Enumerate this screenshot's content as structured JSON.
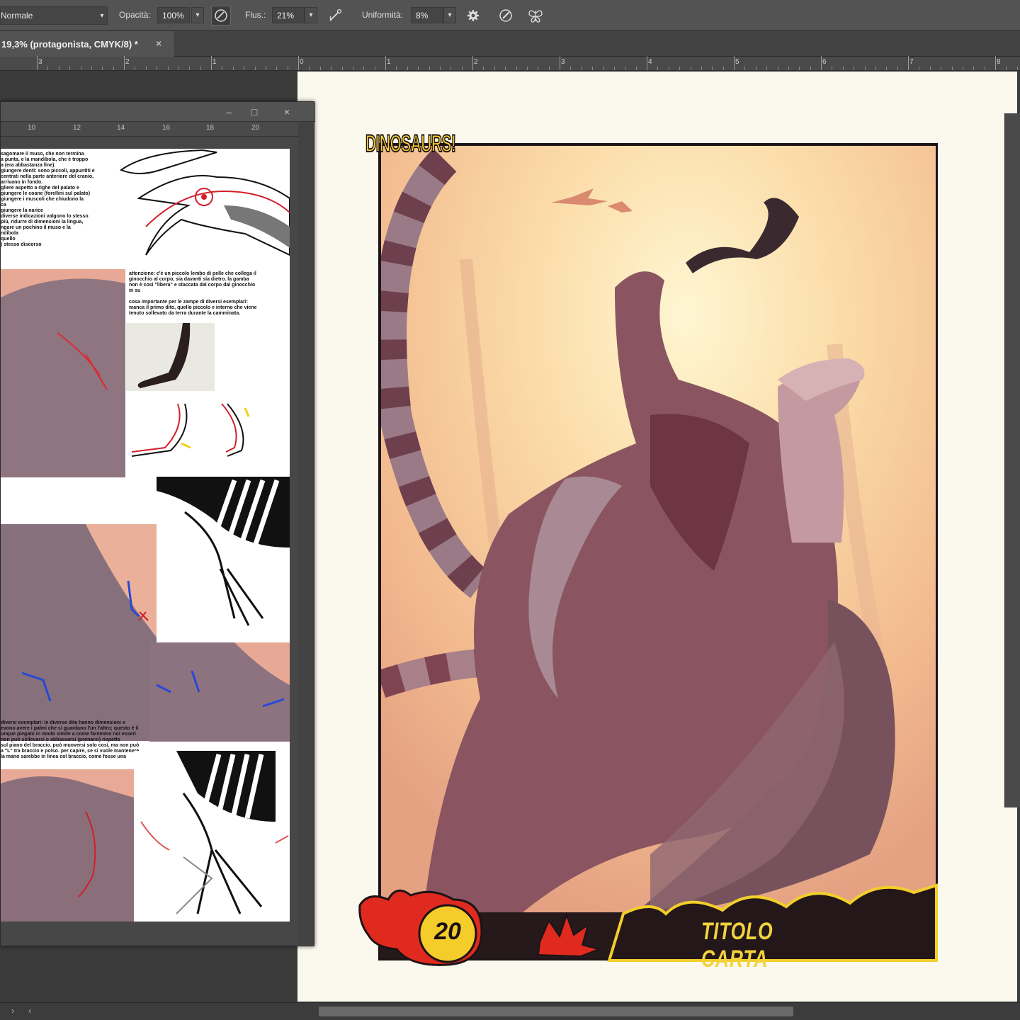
{
  "options_bar": {
    "blend_mode": "Normale",
    "opacity_label": "Opacità:",
    "opacity_value": "100%",
    "flow_label": "Flus.:",
    "flow_value": "21%",
    "smoothing_label": "Uniformità:",
    "smoothing_value": "8%",
    "icons": [
      "pressure-opacity-icon",
      "airbrush-icon",
      "gear-icon",
      "pressure-size-icon",
      "symmetry-butterfly-icon"
    ]
  },
  "document_tab": {
    "title": "19,3% (protagonista, CMYK/8) *",
    "close": "×"
  },
  "ruler": {
    "labels": [
      "3",
      "2",
      "1",
      "0",
      "1",
      "2",
      "3",
      "4",
      "5",
      "6",
      "7",
      "8"
    ]
  },
  "reference_window": {
    "minimize": "–",
    "maximize": "□",
    "close": "×",
    "ruler_labels": [
      "10",
      "12",
      "14",
      "16",
      "18",
      "20"
    ],
    "notes": {
      "skull": "sagomare il muso, che non termina\na punta, e la mandibola, che è troppo\na (era abbastanza fine).\ngiungere denti: sono piccoli, appuntiti e\ncentrati nella parte anteriore del cranio,\narrivano in fondo.\ngliere aspetto a righe del palato e\ngiungere le coane (forellini sul palato)\ngiungere i muscoli che chiudono la\nca\ngiungere la narice\ndiverse indicazioni valgono lo stesso\npiù, ridurre di dimensioni la lingua,\nngare un pochino il muso e la\nndibola\nquello\n) stesso discorso",
      "knee": "attenzione: c'è un piccolo lembo di pelle che collega il\nginocchio al corpo, sia davanti sia dietro. la gamba\nnon è così \"libera\" e staccata dal corpo dal ginocchio\nin su\n\ncosa importante per le zampe di diversi esemplari:\nmanca il primo dito, quello piccolo e interno che viene\ntenuto sollevato da terra durante la camminata.",
      "hands": "diversi esemplari: le diverse dita hanno dimensioni e\nevono avere i palmi che si guardano l'un l'altro; questo è il\nunque piegato in modo simile  a come faremmo noi esseri\nnon può sollevarsi o abbassarsi (pronarsi) rispetto\nsul piano del braccio. può muoversi solo così, ma non può\na \"L\" tra braccio e polso. per capire, se si vuole mantenere\nla mano sarebbe in linea col braccio, come fosse una"
    }
  },
  "card": {
    "logo": "DINOSAURS!",
    "number": "20",
    "title": "TITOLO CARTA"
  },
  "colors": {
    "accent_yellow": "#f5cf2b",
    "flame_red": "#e02a1f",
    "card_frame": "#25191c",
    "paper": "#fbf8ee"
  }
}
